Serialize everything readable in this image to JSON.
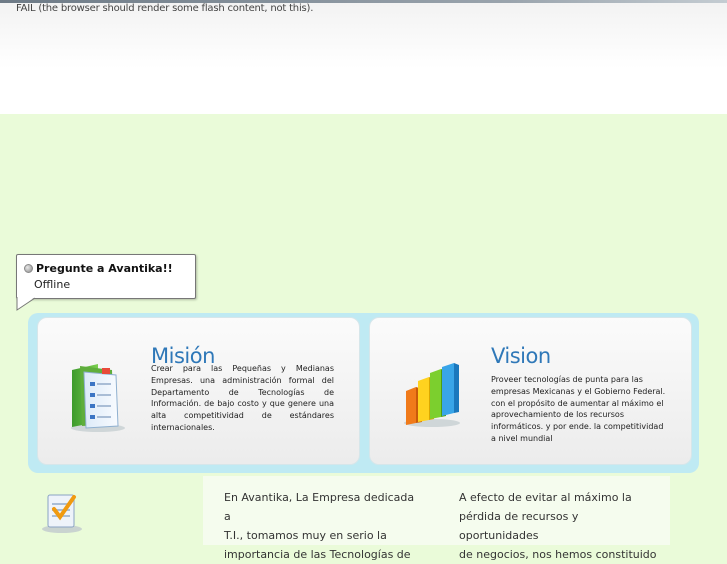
{
  "header": {
    "flash_fallback": "FAIL (the browser should render some flash content, not this)."
  },
  "chat": {
    "title": "Pregunte a Avantika!!",
    "status": "Offline"
  },
  "mision": {
    "title": "Misión",
    "text": "Crear para las Pequeñas y Medianas Empresas. una administración formal del Departamento de Tecnologías de Información. de bajo costo y que genere una alta competitividad de estándares internacionales.",
    "icon": "books-icon"
  },
  "vision": {
    "title": "Vision",
    "text": "Proveer tecnologías de punta para las empresas Mexicanas y el Gobierno Federal. con el propósito de aumentar al máximo el aprovechamiento de los recursos informáticos. y por ende. la competitividad a nivel mundial",
    "icon": "bar-chart-icon"
  },
  "lower": {
    "col1_lines": [
      "En Avantika, La Empresa dedicada a",
      "T.I., tomamos muy en serio la",
      "importancia de las Tecnologías de"
    ],
    "col2_lines": [
      "A efecto de evitar al máximo la",
      "pérdida de recursos y oportunidades",
      "de negocios, nos hemos constituido"
    ],
    "icon": "checklist-icon"
  },
  "colors": {
    "page_bg": "#eafbd9",
    "panel_bg": "#bfeaf3",
    "heading_blue": "#2f78b8"
  }
}
